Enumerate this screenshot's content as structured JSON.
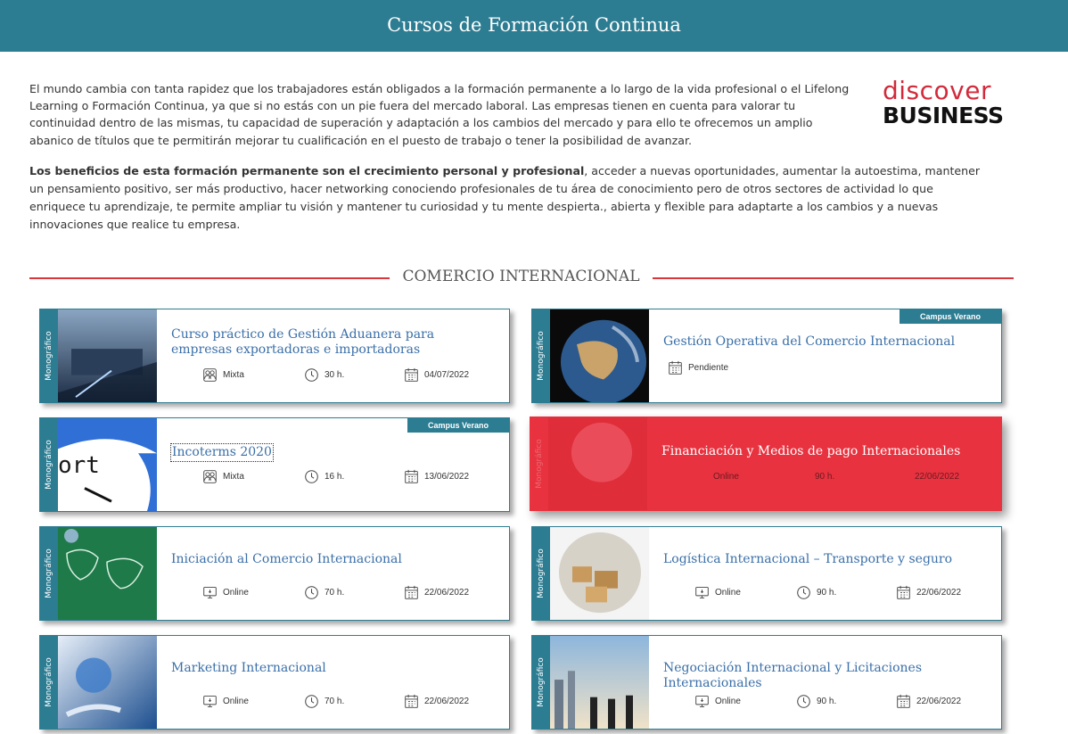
{
  "header": {
    "title": "Cursos de Formación Continua"
  },
  "intro": {
    "paragraph1": "El mundo cambia con tanta rapidez que los trabajadores están obligados a la formación permanente a lo largo de la vida profesional o el Lifelong Learning o Formación Continua, ya que si no estás con un pie fuera del mercado laboral. Las empresas tienen en cuenta para valorar tu continuidad dentro de las mismas, tu capacidad de superación y adaptación a los cambios del mercado y para ello te ofrecemos un amplio abanico de títulos que te permitirán mejorar tu cualificación en el puesto de trabajo o tener la posibilidad de avanzar.",
    "paragraph2_bold": "Los beneficios de esta formación permanente son el crecimiento personal y profesional",
    "paragraph2_rest": ", acceder a nuevas oportunidades, aumentar la autoestima, mantener un pensamiento positivo, ser más productivo, hacer networking conociendo profesionales de tu área de conocimiento pero de otros sectores de actividad lo que enriquece tu aprendizaje, te permite ampliar tu visión y mantener tu curiosidad y tu mente despierta., abierta y flexible para adaptarte a los cambios y a nuevas innovaciones que realice tu empresa."
  },
  "logo": {
    "line1": "discover",
    "line2": "BUSINESS"
  },
  "section": {
    "title": "COMERCIO INTERNACIONAL"
  },
  "colors": {
    "teal": "#2d7d92",
    "red": "#e8323f",
    "link": "#3a6fa8",
    "divider": "#d9363e"
  },
  "courses": [
    {
      "category": "Monográfico",
      "title": "Curso práctico de Gestión Aduanera para empresas exportadoras e importadoras",
      "modality": "Mixta",
      "hours": "30 h.",
      "date": "04/07/2022",
      "badge": ""
    },
    {
      "category": "Monográfico",
      "title": "Gestión Operativa del Comercio Internacional",
      "modality": "Pendiente",
      "hours": "",
      "date": "",
      "badge": "Campus Verano"
    },
    {
      "category": "Monográfico",
      "title": "Incoterms 2020",
      "modality": "Mixta",
      "hours": "16 h.",
      "date": "13/06/2022",
      "badge": "Campus Verano"
    },
    {
      "category": "Monográfico",
      "title": "Financiación y Medios de pago Internacionales",
      "modality": "Online",
      "hours": "90 h.",
      "date": "22/06/2022",
      "badge": ""
    },
    {
      "category": "Monográfico",
      "title": "Iniciación al Comercio Internacional",
      "modality": "Online",
      "hours": "70 h.",
      "date": "22/06/2022",
      "badge": ""
    },
    {
      "category": "Monográfico",
      "title": "Logística Internacional – Transporte y seguro",
      "modality": "Online",
      "hours": "90 h.",
      "date": "22/06/2022",
      "badge": ""
    },
    {
      "category": "Monográfico",
      "title": "Marketing Internacional",
      "modality": "Online",
      "hours": "70 h.",
      "date": "22/06/2022",
      "badge": ""
    },
    {
      "category": "Monográfico",
      "title": "Negociación Internacional y Licitaciones Internacionales",
      "modality": "Online",
      "hours": "90 h.",
      "date": "22/06/2022",
      "badge": ""
    }
  ]
}
